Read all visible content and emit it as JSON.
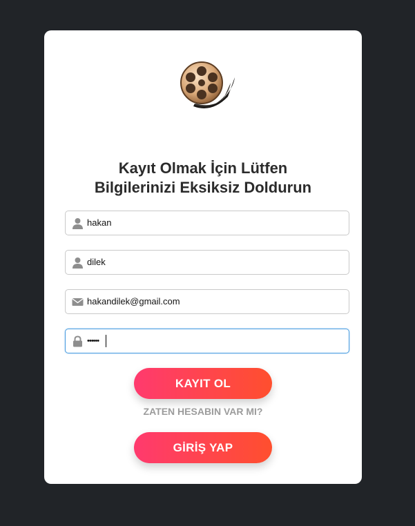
{
  "form": {
    "title_line1": "Kayıt Olmak İçin Lütfen",
    "title_line2": "Bilgilerinizi Eksiksiz Doldurun",
    "fields": [
      {
        "icon": "user-icon",
        "value": "hakan"
      },
      {
        "icon": "user-icon",
        "value": "dilek"
      },
      {
        "icon": "envelope-icon",
        "value": "hakandilek@gmail.com"
      },
      {
        "icon": "lock-icon",
        "value": "••••••"
      }
    ],
    "register_button": "KAYIT OL",
    "account_prompt": "ZATEN HESABIN VAR MI?",
    "login_button": "GİRİŞ YAP"
  },
  "colors": {
    "background": "#212428",
    "card": "#ffffff",
    "button_gradient_start": "#ff3a6e",
    "button_gradient_end": "#ff4f2e",
    "focus_border": "#4a9de0",
    "link": "#9b9b9b"
  }
}
